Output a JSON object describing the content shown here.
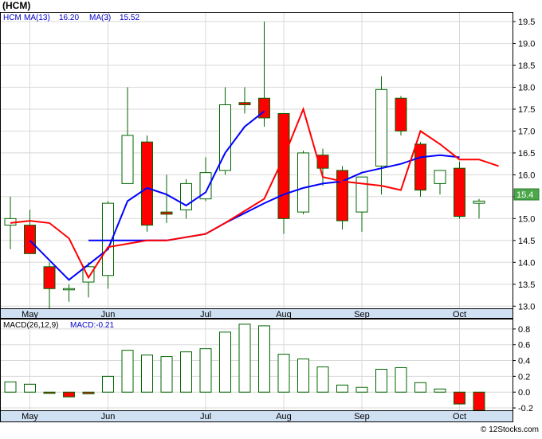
{
  "chart_title": "(HCM)",
  "watermark": "© 12Stocks.com",
  "price_panel": {
    "legend": [
      {
        "text": "HCM",
        "color": "#0000cc"
      },
      {
        "text": "MA(13)",
        "color": "#0000cc"
      },
      {
        "text": "16.20",
        "color": "#0000cc"
      },
      {
        "text": "MA(3)",
        "color": "#0000cc"
      },
      {
        "text": "15.52",
        "color": "#0000cc"
      }
    ],
    "last_price_label": "15.4"
  },
  "macd_panel": {
    "legend": [
      {
        "text": "MACD(26,12,9)",
        "color": "#000000"
      },
      {
        "text": "MACD:-0.21",
        "color": "#0000cc"
      }
    ]
  },
  "colors": {
    "up_candle": "#ffffff",
    "down_candle": "#ff0000",
    "candle_outline": "#006600",
    "ma13": "#0000ff",
    "ma3": "#ff0000",
    "axis_band": "#cfe0f3"
  },
  "chart_data": [
    {
      "type": "candlestick",
      "title": "(HCM)",
      "x_labels": [
        "May",
        "Jun",
        "Jul",
        "Aug",
        "Sep",
        "Oct"
      ],
      "x_label_at": [
        1,
        5,
        10,
        14,
        18,
        23
      ],
      "y_ticks": [
        13.0,
        13.5,
        14.0,
        14.5,
        15.0,
        15.5,
        16.0,
        16.5,
        17.0,
        17.5,
        18.0,
        18.5,
        19.0,
        19.5
      ],
      "ylim": [
        12.95,
        19.72
      ],
      "candles": [
        {
          "o": 14.85,
          "h": 15.5,
          "l": 14.3,
          "c": 15.0
        },
        {
          "o": 14.85,
          "h": 15.2,
          "l": 14.2,
          "c": 14.2
        },
        {
          "o": 13.9,
          "h": 14.0,
          "l": 12.95,
          "c": 13.4
        },
        {
          "o": 13.4,
          "h": 13.5,
          "l": 13.1,
          "c": 13.4
        },
        {
          "o": 13.55,
          "h": 14.0,
          "l": 13.2,
          "c": 13.9
        },
        {
          "o": 13.7,
          "h": 15.4,
          "l": 13.4,
          "c": 15.35
        },
        {
          "o": 15.8,
          "h": 18.0,
          "l": 15.8,
          "c": 16.9
        },
        {
          "o": 16.75,
          "h": 16.9,
          "l": 14.7,
          "c": 14.85
        },
        {
          "o": 15.15,
          "h": 16.0,
          "l": 14.9,
          "c": 15.1
        },
        {
          "o": 15.2,
          "h": 15.9,
          "l": 15.0,
          "c": 15.8
        },
        {
          "o": 15.45,
          "h": 16.4,
          "l": 15.4,
          "c": 16.05
        },
        {
          "o": 16.1,
          "h": 18.0,
          "l": 16.0,
          "c": 17.6
        },
        {
          "o": 17.65,
          "h": 18.0,
          "l": 17.4,
          "c": 17.6
        },
        {
          "o": 17.75,
          "h": 19.5,
          "l": 17.1,
          "c": 17.3
        },
        {
          "o": 17.4,
          "h": 17.4,
          "l": 14.65,
          "c": 15.0
        },
        {
          "o": 15.15,
          "h": 16.55,
          "l": 15.1,
          "c": 16.5
        },
        {
          "o": 16.45,
          "h": 16.6,
          "l": 15.75,
          "c": 16.15
        },
        {
          "o": 16.1,
          "h": 16.2,
          "l": 14.75,
          "c": 14.95
        },
        {
          "o": 15.15,
          "h": 15.95,
          "l": 14.7,
          "c": 15.95
        },
        {
          "o": 16.2,
          "h": 18.25,
          "l": 15.55,
          "c": 17.95
        },
        {
          "o": 17.75,
          "h": 17.8,
          "l": 16.9,
          "c": 17.0
        },
        {
          "o": 16.7,
          "h": 16.75,
          "l": 15.5,
          "c": 15.65
        },
        {
          "o": 15.8,
          "h": 16.1,
          "l": 15.55,
          "c": 16.1
        },
        {
          "o": 16.15,
          "h": 16.3,
          "l": 15.0,
          "c": 15.05
        },
        {
          "o": 15.35,
          "h": 15.45,
          "l": 15.0,
          "c": 15.4
        }
      ],
      "series": [
        {
          "name": "MA(13)",
          "color": "#0000ff",
          "points": [
            [
              1,
              14.5
            ],
            [
              3,
              13.6
            ],
            [
              5,
              14.3
            ],
            [
              6,
              15.4
            ],
            [
              7,
              15.7
            ],
            [
              8,
              15.55
            ],
            [
              9,
              15.3
            ],
            [
              10,
              15.6
            ],
            [
              11,
              16.5
            ],
            [
              12,
              17.1
            ],
            [
              13,
              17.45
            ]
          ]
        },
        {
          "name": "MA(13)",
          "color": "#0000ff",
          "points": [
            [
              4,
              14.5
            ],
            [
              8,
              14.5
            ],
            [
              10,
              14.65
            ],
            [
              11,
              14.9
            ],
            [
              13,
              15.35
            ],
            [
              14,
              15.55
            ],
            [
              15,
              15.7
            ],
            [
              16,
              15.8
            ],
            [
              17,
              15.85
            ],
            [
              18,
              16.05
            ],
            [
              20,
              16.25
            ],
            [
              21,
              16.4
            ],
            [
              22,
              16.45
            ],
            [
              23,
              16.4
            ]
          ]
        },
        {
          "name": "MA(3)",
          "color": "#ff0000",
          "points": [
            [
              0,
              14.9
            ],
            [
              1,
              14.95
            ],
            [
              2,
              14.9
            ],
            [
              3,
              14.55
            ],
            [
              4,
              13.65
            ],
            [
              5,
              14.35
            ],
            [
              7,
              14.5
            ],
            [
              8,
              14.5
            ],
            [
              10,
              14.65
            ],
            [
              11,
              14.9
            ],
            [
              13,
              15.45
            ],
            [
              14,
              16.4
            ],
            [
              15,
              17.5
            ],
            [
              16,
              15.95
            ],
            [
              17,
              15.85
            ],
            [
              19,
              15.75
            ],
            [
              20,
              15.65
            ],
            [
              21,
              17.0
            ],
            [
              22,
              16.7
            ],
            [
              23,
              16.35
            ],
            [
              24,
              16.35
            ],
            [
              25,
              16.2
            ]
          ]
        }
      ]
    },
    {
      "type": "bar",
      "title": "MACD(26,12,9)",
      "x_labels": [
        "May",
        "Jun",
        "Jul",
        "Aug",
        "Sep",
        "Oct"
      ],
      "x_label_at": [
        1,
        5,
        10,
        14,
        18,
        23
      ],
      "y_ticks": [
        -0.2,
        0.0,
        0.2,
        0.4,
        0.6,
        0.8
      ],
      "ylim": [
        -0.23,
        0.93
      ],
      "values": [
        0.13,
        0.1,
        -0.01,
        -0.06,
        -0.02,
        0.2,
        0.53,
        0.47,
        0.45,
        0.51,
        0.55,
        0.76,
        0.86,
        0.84,
        0.48,
        0.42,
        0.32,
        0.09,
        0.06,
        0.29,
        0.31,
        0.12,
        0.04,
        -0.15,
        -0.23
      ]
    }
  ]
}
